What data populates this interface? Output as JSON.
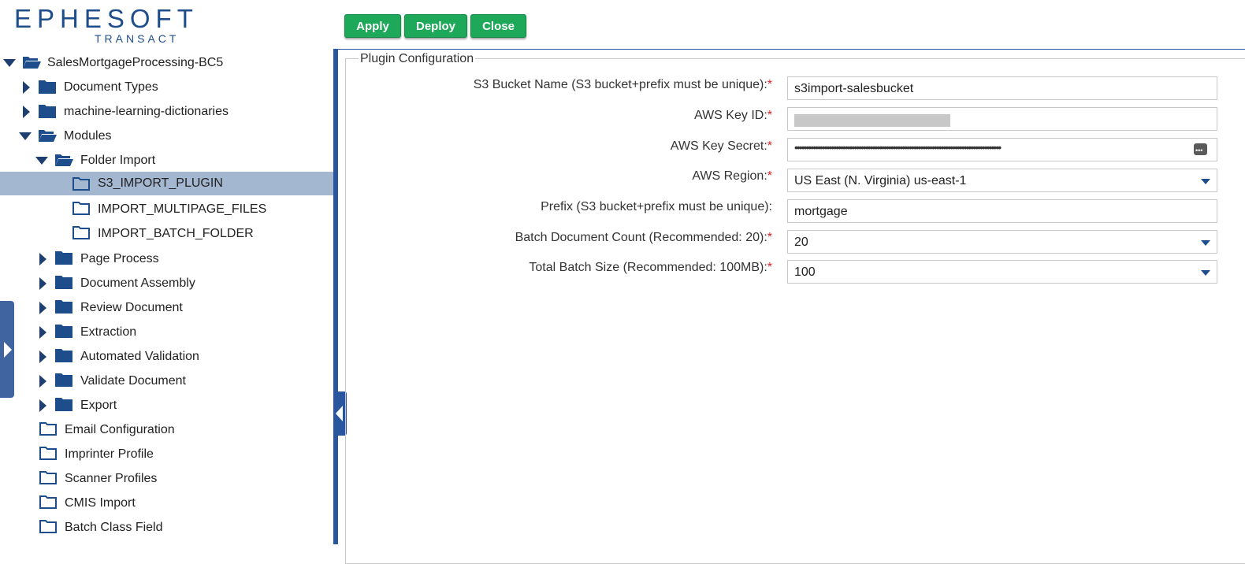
{
  "logo": {
    "main": "EPHESOFT",
    "sub": "TRANSACT"
  },
  "toolbar": {
    "apply_label": "Apply",
    "deploy_label": "Deploy",
    "close_label": "Close"
  },
  "tree": {
    "items": [
      {
        "label": "SalesMortgageProcessing-BC5"
      },
      {
        "label": "Document Types"
      },
      {
        "label": "machine-learning-dictionaries"
      },
      {
        "label": "Modules"
      },
      {
        "label": "Folder Import"
      },
      {
        "label": "S3_IMPORT_PLUGIN",
        "selected": true
      },
      {
        "label": "IMPORT_MULTIPAGE_FILES"
      },
      {
        "label": "IMPORT_BATCH_FOLDER"
      },
      {
        "label": "Page Process"
      },
      {
        "label": "Document Assembly"
      },
      {
        "label": "Review Document"
      },
      {
        "label": "Extraction"
      },
      {
        "label": "Automated Validation"
      },
      {
        "label": "Validate Document"
      },
      {
        "label": "Export"
      },
      {
        "label": "Email Configuration"
      },
      {
        "label": "Imprinter Profile"
      },
      {
        "label": "Scanner Profiles"
      },
      {
        "label": "CMIS Import"
      },
      {
        "label": "Batch Class Field"
      }
    ]
  },
  "config": {
    "legend": "Plugin Configuration",
    "required_mark": "*",
    "fields": [
      {
        "label": "S3 Bucket Name (S3 bucket+prefix must be unique):",
        "required": true,
        "value": "s3import-salesbucket",
        "kind": "text"
      },
      {
        "label": "AWS Key ID:",
        "required": true,
        "value": "",
        "kind": "masked"
      },
      {
        "label": "AWS Key Secret:",
        "required": true,
        "value": "••••••••••••••••••••••••••••••••••••••••••••••••••••••••••••••••••••••••••••••••••••••••••",
        "kind": "password"
      },
      {
        "label": "AWS Region:",
        "required": true,
        "value": "US East (N. Virginia) us-east-1",
        "kind": "select"
      },
      {
        "label": "Prefix (S3 bucket+prefix must be unique):",
        "required": false,
        "value": "mortgage",
        "kind": "text"
      },
      {
        "label": "Batch Document Count (Recommended: 20):",
        "required": true,
        "value": "20",
        "kind": "select"
      },
      {
        "label": "Total Batch Size (Recommended: 100MB):",
        "required": true,
        "value": "100",
        "kind": "select"
      }
    ]
  },
  "colors": {
    "accent": "#1e4d8c",
    "button": "#1ea85a",
    "selection": "#a4b7d1",
    "required": "#e02020"
  }
}
